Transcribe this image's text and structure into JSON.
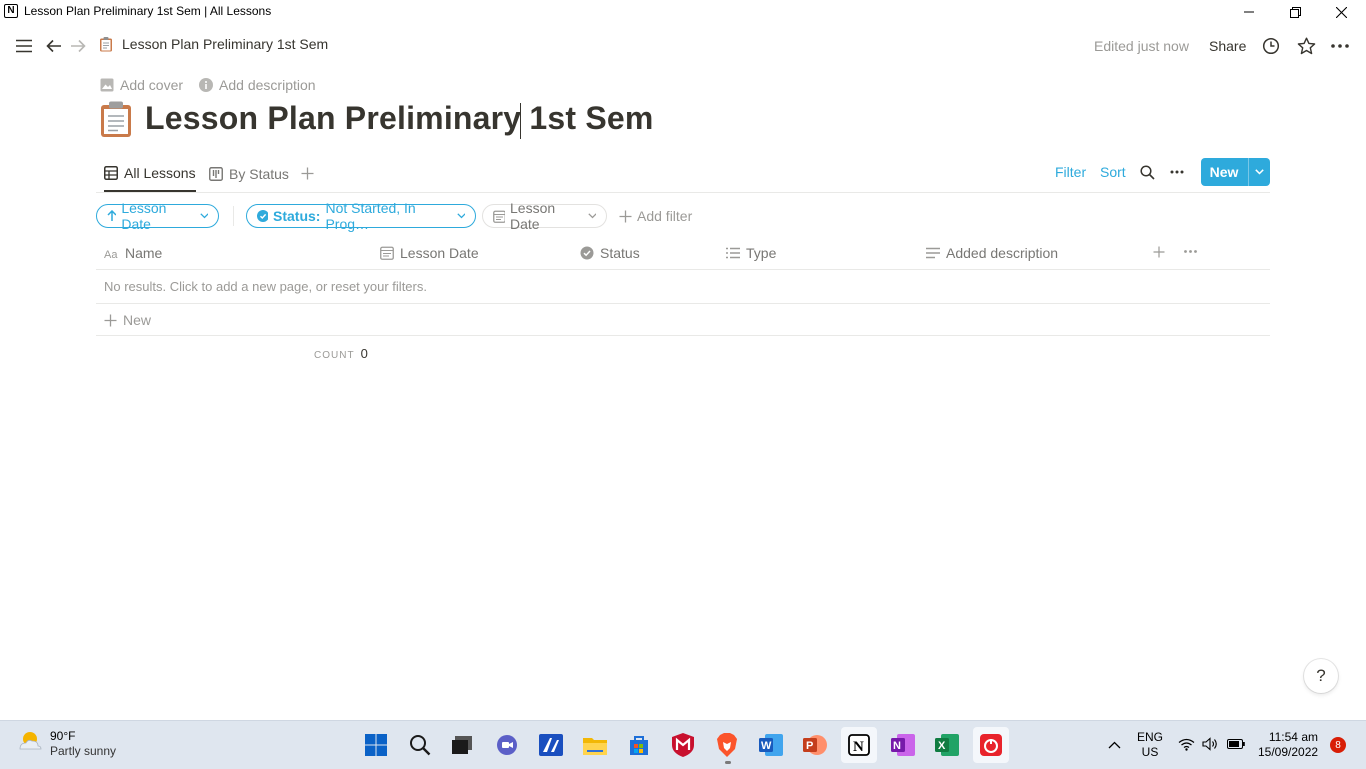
{
  "window": {
    "title": "Lesson Plan Preliminary 1st Sem | All Lessons",
    "app_icon": "N"
  },
  "topbar": {
    "breadcrumb": "Lesson Plan Preliminary 1st Sem",
    "edited": "Edited just now",
    "share": "Share"
  },
  "page": {
    "add_cover": "Add cover",
    "add_description": "Add description",
    "title_part1": "Lesson Plan Preliminary",
    "title_part2": " 1st Sem",
    "icon": "clipboard-icon"
  },
  "views": {
    "tabs": [
      {
        "label": "All Lessons",
        "active": true
      },
      {
        "label": "By Status",
        "active": false
      }
    ],
    "filter": "Filter",
    "sort": "Sort",
    "new_label": "New"
  },
  "filters": {
    "sort_pill": "Lesson Date",
    "status_key": "Status:",
    "status_value": "Not Started, In Prog…",
    "date_pill": "Lesson Date",
    "add_filter": "Add filter"
  },
  "table": {
    "columns": [
      {
        "label": "Name",
        "icon": "text-aa-icon"
      },
      {
        "label": "Lesson Date",
        "icon": "calendar-icon"
      },
      {
        "label": "Status",
        "icon": "status-icon"
      },
      {
        "label": "Type",
        "icon": "list-icon"
      },
      {
        "label": "Added description",
        "icon": "text-lines-icon"
      }
    ],
    "empty_message": "No results. Click to add a new page, or reset your filters.",
    "new_row": "New",
    "count_label": "COUNT",
    "count_value": "0"
  },
  "help": "?",
  "taskbar": {
    "weather_temp": "90°F",
    "weather_desc": "Partly sunny",
    "lang_top": "ENG",
    "lang_bottom": "US",
    "time": "11:54 am",
    "date": "15/09/2022",
    "notifications": "8"
  },
  "colors": {
    "accent": "#2eaadc",
    "text": "#37352f",
    "muted": "#9b9a97",
    "taskbar": "#dfe6ef"
  }
}
